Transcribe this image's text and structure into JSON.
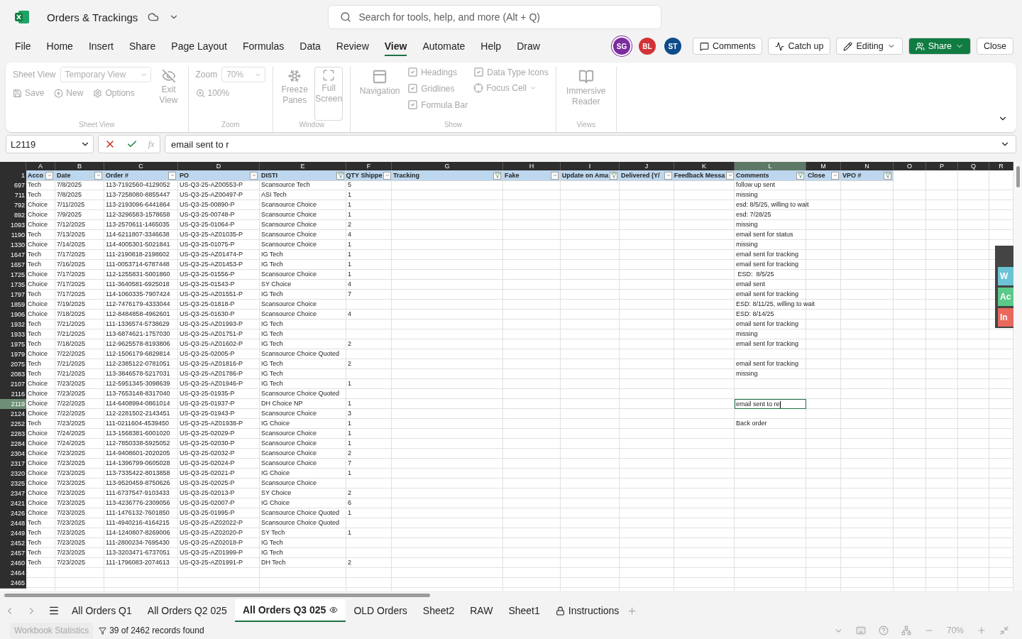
{
  "app": {
    "title": "Orders & Trackings",
    "search_placeholder": "Search for tools, help, and more (Alt + Q)"
  },
  "menu_tabs": [
    {
      "label": "File",
      "selected": false
    },
    {
      "label": "Home",
      "selected": false
    },
    {
      "label": "Insert",
      "selected": false
    },
    {
      "label": "Share",
      "selected": false
    },
    {
      "label": "Page Layout",
      "selected": false
    },
    {
      "label": "Formulas",
      "selected": false
    },
    {
      "label": "Data",
      "selected": false
    },
    {
      "label": "Review",
      "selected": false
    },
    {
      "label": "View",
      "selected": true
    },
    {
      "label": "Automate",
      "selected": false
    },
    {
      "label": "Help",
      "selected": false
    },
    {
      "label": "Draw",
      "selected": false
    }
  ],
  "avatars": [
    {
      "initials": "SG",
      "color": "#7b2c9e"
    },
    {
      "initials": "BL",
      "color": "#d13438"
    },
    {
      "initials": "ST",
      "color": "#0f4c8a"
    }
  ],
  "actions": [
    {
      "label": "Comments",
      "kind": "comments"
    },
    {
      "label": "Catch up",
      "kind": "catchup"
    },
    {
      "label": "Editing",
      "kind": "editing"
    },
    {
      "label": "Share",
      "kind": "share"
    },
    {
      "label": "Close",
      "kind": "close"
    }
  ],
  "ribbon": [
    {
      "kind": "sheet_view",
      "caption": "Sheet View",
      "select_label": "Sheet View",
      "select_value": "Temporary View",
      "buttons": [
        "Save",
        "New",
        "Options"
      ],
      "exit": "Exit View"
    },
    {
      "kind": "zoom",
      "caption": "Zoom",
      "select_label": "Zoom",
      "select_value": "70%",
      "reset": "100%"
    },
    {
      "kind": "window",
      "caption": "Window",
      "freeze": "Freeze Panes",
      "full": "Full Screen"
    },
    {
      "kind": "show",
      "caption": "Show",
      "navigation": "Navigation",
      "checks": [
        {
          "label": "Headings",
          "checked": true
        },
        {
          "label": "Gridlines",
          "checked": true
        },
        {
          "label": "Formula Bar",
          "checked": true
        },
        {
          "label": "Data Type Icons",
          "checked": true
        }
      ],
      "focus": "Focus Cell"
    },
    {
      "kind": "views",
      "caption": "Views",
      "button": "Immersive Reader"
    }
  ],
  "formula_bar": {
    "name_box": "L2119",
    "function_label": "fx",
    "value": "email sent to r"
  },
  "columns": [
    {
      "letter": "A",
      "header": "Acco",
      "filtered": false,
      "selected": false
    },
    {
      "letter": "B",
      "header": "Date",
      "filtered": false,
      "selected": false
    },
    {
      "letter": "C",
      "header": "Order #",
      "filtered": false,
      "selected": false
    },
    {
      "letter": "D",
      "header": "PO",
      "filtered": false,
      "selected": false
    },
    {
      "letter": "E",
      "header": "DISTI",
      "filtered": true,
      "selected": false
    },
    {
      "letter": "F",
      "header": "QTY Shippe",
      "filtered": false,
      "selected": false
    },
    {
      "letter": "G",
      "header": "Tracking",
      "filtered": true,
      "selected": false
    },
    {
      "letter": "H",
      "header": "Fake",
      "filtered": false,
      "selected": false
    },
    {
      "letter": "I",
      "header": "Update on Ama",
      "filtered": true,
      "selected": false
    },
    {
      "letter": "J",
      "header": "Delivered (Y/",
      "filtered": false,
      "selected": false
    },
    {
      "letter": "K",
      "header": "Feedback Messa",
      "filtered": false,
      "selected": false
    },
    {
      "letter": "L",
      "header": "Comments",
      "filtered": true,
      "selected": true
    },
    {
      "letter": "M",
      "header": "Close",
      "filtered": false,
      "selected": false
    },
    {
      "letter": "N",
      "header": "VPO #",
      "filtered": true,
      "selected": false
    },
    {
      "letter": "O",
      "selected": false
    },
    {
      "letter": "P",
      "selected": false
    },
    {
      "letter": "Q",
      "selected": false
    },
    {
      "letter": "R",
      "selected": false
    }
  ],
  "header_row": "1",
  "rows": [
    {
      "n": "697",
      "account": "Tech",
      "date": "7/8/2025",
      "order": "113-7192560-4129052",
      "po": "US-Q3-25-AZ00553-P",
      "disti": "Scansource Tech",
      "qty": "5",
      "comments": "follow up sent",
      "selected": false
    },
    {
      "n": "711",
      "account": "Tech",
      "date": "7/8/2025",
      "order": "113-7258080-8855447",
      "po": "US-Q3-25-AZ00497-P",
      "disti": "ASI Tech",
      "qty": "1",
      "comments": "missing",
      "selected": false
    },
    {
      "n": "792",
      "account": "Choice",
      "date": "7/11/2025",
      "order": "113-2193096-6441864",
      "po": "US-Q3-25-00890-P",
      "disti": "Scansource Choice",
      "qty": "1",
      "comments": "esd: 8/5/25, willing to wait",
      "selected": false
    },
    {
      "n": "892",
      "account": "Choice",
      "date": "7/9/2025",
      "order": "112-3296583-1578658",
      "po": "US-Q3-25-00748-P",
      "disti": "Scansource Choice",
      "qty": "1",
      "comments": "esd: 7/28/25",
      "selected": false
    },
    {
      "n": "1093",
      "account": "Choice",
      "date": "7/12/2025",
      "order": "113-2570611-1465035",
      "po": "US-Q3-25-01064-P",
      "disti": "Scansource Choice",
      "qty": "2",
      "comments": "missing",
      "selected": false
    },
    {
      "n": "1190",
      "account": "Tech",
      "date": "7/13/2025",
      "order": "114-6211807-3346638",
      "po": "US-Q3-25-AZ01035-P",
      "disti": "Scansource Choice",
      "qty": "4",
      "comments": "email sent for status",
      "selected": false
    },
    {
      "n": "1330",
      "account": "Choice",
      "date": "7/14/2025",
      "order": "114-4005301-5021841",
      "po": "US-Q3-25-01075-P",
      "disti": "Scansource Choice",
      "qty": "1",
      "comments": "missing",
      "selected": false
    },
    {
      "n": "1647",
      "account": "Tech",
      "date": "7/17/2025",
      "order": "111-2190818-2198602",
      "po": "US-Q3-25-AZ01474-P",
      "disti": "IG Tech",
      "qty": "1",
      "comments": "email sent for tracking",
      "selected": false
    },
    {
      "n": "1657",
      "account": "Tech",
      "date": "7/16/2025",
      "order": "111-0053714-6787448",
      "po": "US-Q3-25-AZ01453-P",
      "disti": "IG Tech",
      "qty": "1",
      "comments": "email sent for tracking",
      "selected": false
    },
    {
      "n": "1725",
      "account": "Choice",
      "date": "7/17/2025",
      "order": "112-1255831-5001860",
      "po": "US-Q3-25-01556-P",
      "disti": "Scansource Choice",
      "qty": "1",
      "comments": " ESD:  8/5/25",
      "selected": false
    },
    {
      "n": "1735",
      "account": "Choice",
      "date": "7/17/2025",
      "order": "111-3640581-6925018",
      "po": "US-Q3-25-01543-P",
      "disti": "SY Choice",
      "qty": "4",
      "comments": "email sent",
      "selected": false
    },
    {
      "n": "1797",
      "account": "Tech",
      "date": "7/17/2025",
      "order": "114-1060335-7907424",
      "po": "US-Q3-25-AZ01551-P",
      "disti": "IG Tech",
      "qty": "7",
      "comments": "email sent for tracking",
      "selected": false
    },
    {
      "n": "1859",
      "account": "Choice",
      "date": "7/19/2025",
      "order": "112-7476179-4333044",
      "po": "US-Q3-25-01818-P",
      "disti": "Scansource Choice",
      "comments": "ESD: 8/11/25, willing to wait",
      "selected": false
    },
    {
      "n": "1906",
      "account": "Choice",
      "date": "7/18/2025",
      "order": "112-8484858-4962601",
      "po": "US-Q3-25-01630-P",
      "disti": "Scansource Choice",
      "qty": "4",
      "comments": "ESD: 8/14/25",
      "selected": false
    },
    {
      "n": "1932",
      "account": "Tech",
      "date": "7/21/2025",
      "order": "111-1336574-5738629",
      "po": "US-Q3-25-AZ01993-P",
      "disti": "IG Tech",
      "comments": "email sent for tracking",
      "selected": false
    },
    {
      "n": "1933",
      "account": "Tech",
      "date": "7/21/2025",
      "order": "113-6874621-1757030",
      "po": "US-Q3-25-AZ01751-P",
      "disti": "IG Tech",
      "comments": "missing",
      "selected": false
    },
    {
      "n": "1975",
      "account": "Tech",
      "date": "7/18/2025",
      "order": "112-9625578-8193806",
      "po": "US-Q3-25-AZ01602-P",
      "disti": "IG Tech",
      "qty": "2",
      "comments": "email sent for tracking",
      "selected": false
    },
    {
      "n": "1979",
      "account": "Choice",
      "date": "7/22/2025",
      "order": "112-1506179-6829814",
      "po": "US-Q3-25-02005-P",
      "disti": "Scansource Choice Quoted",
      "selected": false
    },
    {
      "n": "2075",
      "account": "Tech",
      "date": "7/21/2025",
      "order": "112-2385122-0781051",
      "po": "US-Q3-25-AZ01816-P",
      "disti": "IG Tech",
      "qty": "2",
      "comments": "email sent for tracking",
      "selected": false
    },
    {
      "n": "2083",
      "account": "Tech",
      "date": "7/21/2025",
      "order": "113-3846578-5217031",
      "po": "US-Q3-25-AZ01786-P",
      "disti": "IG Tech",
      "comments": "missing",
      "selected": false
    },
    {
      "n": "2107",
      "account": "Choice",
      "date": "7/23/2025",
      "order": "112-5951345-3098639",
      "po": "US-Q3-25-AZ01946-P",
      "disti": "IG Tech",
      "qty": "1",
      "selected": false
    },
    {
      "n": "2116",
      "account": "Choice",
      "date": "7/23/2025",
      "order": "113-7653148-8317040",
      "po": "US-Q3-25-01935-P",
      "disti": "Scansource Choice Quoted",
      "selected": false
    },
    {
      "n": "2119",
      "account": "Choice",
      "date": "7/22/2025",
      "order": "114-6408994-0861014",
      "po": "US-Q3-25-01937-P",
      "disti": "DH Choice NP",
      "qty": "1",
      "comments": "email sent to re",
      "selected": true
    },
    {
      "n": "2124",
      "account": "Choice",
      "date": "7/22/2025",
      "order": "112-2281502-2143451",
      "po": "US-Q3-25-01943-P",
      "disti": "Scansource Choice",
      "qty": "3",
      "selected": false
    },
    {
      "n": "2252",
      "account": "Tech",
      "date": "7/23/2025",
      "order": "111-0211604-4539450",
      "po": "US-Q3-25-AZ01938-P",
      "disti": "IG Choice",
      "qty": "1",
      "comments": "Back order",
      "selected": false
    },
    {
      "n": "2283",
      "account": "Choice",
      "date": "7/24/2025",
      "order": "113-1568381-6001020",
      "po": "US-Q3-25-02029-P",
      "disti": "Scansource Choice",
      "qty": "1",
      "selected": false
    },
    {
      "n": "2284",
      "account": "Choice",
      "date": "7/24/2025",
      "order": "112-7850338-5925052",
      "po": "US-Q3-25-02030-P",
      "disti": "Scansource Choice",
      "qty": "1",
      "selected": false
    },
    {
      "n": "2304",
      "account": "Choice",
      "date": "7/23/2025",
      "order": "114-9408601-2020205",
      "po": "US-Q3-25-02032-P",
      "disti": "Scansource Choice",
      "qty": "2",
      "selected": false
    },
    {
      "n": "2317",
      "account": "Choice",
      "date": "7/23/2025",
      "order": "114-1396799-0605028",
      "po": "US-Q3-25-02024-P",
      "disti": "Scansource Choice",
      "qty": "7",
      "selected": false
    },
    {
      "n": "2320",
      "account": "Choice",
      "date": "7/23/2025",
      "order": "113-7335422-8013858",
      "po": "US-Q3-25-02021-P",
      "disti": "IG Choice",
      "qty": "1",
      "selected": false
    },
    {
      "n": "2325",
      "account": "Choice",
      "date": "7/23/2025",
      "order": "113-9520459-8750626",
      "po": "US-Q3-25-02025-P",
      "disti": "Scansource Choice",
      "selected": false
    },
    {
      "n": "2347",
      "account": "Choice",
      "date": "7/23/2025",
      "order": "111-6737547-9103433",
      "po": "US-Q3-25-02013-P",
      "disti": "SY Choice",
      "qty": "2",
      "selected": false
    },
    {
      "n": "2421",
      "account": "Choice",
      "date": "7/23/2025",
      "order": "113-4236776-2309056",
      "po": "US-Q3-25-02007-P",
      "disti": "IG Choice",
      "qty": "6",
      "selected": false
    },
    {
      "n": "2426",
      "account": "Choice",
      "date": "7/23/2025",
      "order": "111-1476132-7601850",
      "po": "US-Q3-25-01995-P",
      "disti": "Scansource Choice Quoted",
      "qty": "1",
      "selected": false
    },
    {
      "n": "2448",
      "account": "Tech",
      "date": "7/23/2025",
      "order": "111-4940216-4164215",
      "po": "US-Q3-25-AZ02022-P",
      "disti": "Scansource Choice Quoted",
      "selected": false
    },
    {
      "n": "2449",
      "account": "Tech",
      "date": "7/23/2025",
      "order": "114-1240807-8269006",
      "po": "US-Q3-25-AZ02020-P",
      "disti": "SY Tech",
      "qty": "1",
      "selected": false
    },
    {
      "n": "2452",
      "account": "Tech",
      "date": "7/23/2025",
      "order": "111-2800234-7695430",
      "po": "US-Q3-25-AZ02018-P",
      "disti": "IG Tech",
      "selected": false
    },
    {
      "n": "2457",
      "account": "Tech",
      "date": "7/23/2025",
      "order": "113-3203471-6737051",
      "po": "US-Q3-25-AZ01999-P",
      "disti": "IG Tech",
      "selected": false
    },
    {
      "n": "2460",
      "account": "Tech",
      "date": "7/23/2025",
      "order": "111-1796083-2074613",
      "po": "US-Q3-25-AZ01991-P",
      "disti": "DH Tech",
      "qty": "2",
      "selected": false
    },
    {
      "n": "2464",
      "selected": false
    },
    {
      "n": "2465",
      "selected": false
    }
  ],
  "side_tabs": [
    {
      "label": "W",
      "color": "#6cc3d5"
    },
    {
      "label": "Ac",
      "color": "#5cc98a"
    },
    {
      "label": "In",
      "color": "#e8695c"
    }
  ],
  "sheet_tabs": [
    {
      "label": "All Orders Q1",
      "selected": false,
      "kind": "plain"
    },
    {
      "label": "All Orders Q2 025",
      "selected": false,
      "kind": "plain"
    },
    {
      "label": "All Orders Q3 025",
      "selected": true,
      "kind": "view"
    },
    {
      "label": "OLD Orders",
      "selected": false,
      "kind": "plain"
    },
    {
      "label": "Sheet2",
      "selected": false,
      "kind": "plain"
    },
    {
      "label": "RAW",
      "selected": false,
      "kind": "plain"
    },
    {
      "label": "Sheet1",
      "selected": false,
      "kind": "plain"
    },
    {
      "label": "Instructions",
      "selected": false,
      "kind": "locked"
    }
  ],
  "status_bar": {
    "statistics": "Workbook Statistics",
    "records": "39 of 2462 records found",
    "zoom": "70%"
  }
}
